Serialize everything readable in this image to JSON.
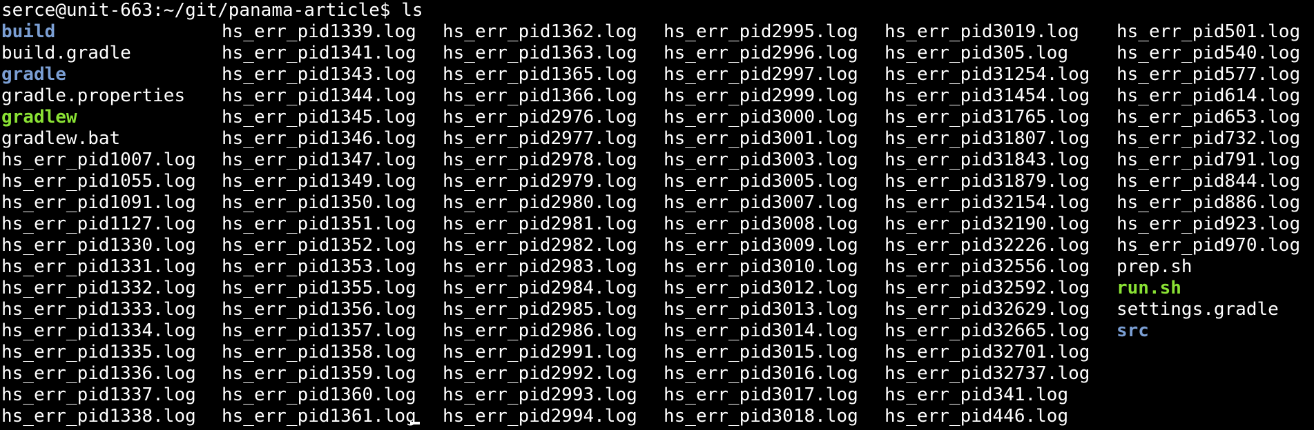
{
  "terminal": {
    "prompt": "serce@unit-663:~/git/panama-article$",
    "command": "ls"
  },
  "colors": {
    "background": "#000000",
    "text": "#ffffff",
    "directory": "#7b9fd4",
    "executable": "#8ae234"
  },
  "listing": {
    "columns": [
      [
        {
          "name": "build",
          "kind": "dir"
        },
        {
          "name": "build.gradle",
          "kind": "file"
        },
        {
          "name": "gradle",
          "kind": "dir"
        },
        {
          "name": "gradle.properties",
          "kind": "file"
        },
        {
          "name": "gradlew",
          "kind": "exec"
        },
        {
          "name": "gradlew.bat",
          "kind": "file"
        },
        {
          "name": "hs_err_pid1007.log",
          "kind": "file"
        },
        {
          "name": "hs_err_pid1055.log",
          "kind": "file"
        },
        {
          "name": "hs_err_pid1091.log",
          "kind": "file"
        },
        {
          "name": "hs_err_pid1127.log",
          "kind": "file"
        },
        {
          "name": "hs_err_pid1330.log",
          "kind": "file"
        },
        {
          "name": "hs_err_pid1331.log",
          "kind": "file"
        },
        {
          "name": "hs_err_pid1332.log",
          "kind": "file"
        },
        {
          "name": "hs_err_pid1333.log",
          "kind": "file"
        },
        {
          "name": "hs_err_pid1334.log",
          "kind": "file"
        },
        {
          "name": "hs_err_pid1335.log",
          "kind": "file"
        },
        {
          "name": "hs_err_pid1336.log",
          "kind": "file"
        },
        {
          "name": "hs_err_pid1337.log",
          "kind": "file"
        },
        {
          "name": "hs_err_pid1338.log",
          "kind": "file"
        }
      ],
      [
        {
          "name": "hs_err_pid1339.log",
          "kind": "file"
        },
        {
          "name": "hs_err_pid1341.log",
          "kind": "file"
        },
        {
          "name": "hs_err_pid1343.log",
          "kind": "file"
        },
        {
          "name": "hs_err_pid1344.log",
          "kind": "file"
        },
        {
          "name": "hs_err_pid1345.log",
          "kind": "file"
        },
        {
          "name": "hs_err_pid1346.log",
          "kind": "file"
        },
        {
          "name": "hs_err_pid1347.log",
          "kind": "file"
        },
        {
          "name": "hs_err_pid1349.log",
          "kind": "file"
        },
        {
          "name": "hs_err_pid1350.log",
          "kind": "file"
        },
        {
          "name": "hs_err_pid1351.log",
          "kind": "file"
        },
        {
          "name": "hs_err_pid1352.log",
          "kind": "file"
        },
        {
          "name": "hs_err_pid1353.log",
          "kind": "file"
        },
        {
          "name": "hs_err_pid1355.log",
          "kind": "file"
        },
        {
          "name": "hs_err_pid1356.log",
          "kind": "file"
        },
        {
          "name": "hs_err_pid1357.log",
          "kind": "file"
        },
        {
          "name": "hs_err_pid1358.log",
          "kind": "file"
        },
        {
          "name": "hs_err_pid1359.log",
          "kind": "file"
        },
        {
          "name": "hs_err_pid1360.log",
          "kind": "file"
        },
        {
          "name": "hs_err_pid1361.log",
          "kind": "file"
        }
      ],
      [
        {
          "name": "hs_err_pid1362.log",
          "kind": "file"
        },
        {
          "name": "hs_err_pid1363.log",
          "kind": "file"
        },
        {
          "name": "hs_err_pid1365.log",
          "kind": "file"
        },
        {
          "name": "hs_err_pid1366.log",
          "kind": "file"
        },
        {
          "name": "hs_err_pid2976.log",
          "kind": "file"
        },
        {
          "name": "hs_err_pid2977.log",
          "kind": "file"
        },
        {
          "name": "hs_err_pid2978.log",
          "kind": "file"
        },
        {
          "name": "hs_err_pid2979.log",
          "kind": "file"
        },
        {
          "name": "hs_err_pid2980.log",
          "kind": "file"
        },
        {
          "name": "hs_err_pid2981.log",
          "kind": "file"
        },
        {
          "name": "hs_err_pid2982.log",
          "kind": "file"
        },
        {
          "name": "hs_err_pid2983.log",
          "kind": "file"
        },
        {
          "name": "hs_err_pid2984.log",
          "kind": "file"
        },
        {
          "name": "hs_err_pid2985.log",
          "kind": "file"
        },
        {
          "name": "hs_err_pid2986.log",
          "kind": "file"
        },
        {
          "name": "hs_err_pid2991.log",
          "kind": "file"
        },
        {
          "name": "hs_err_pid2992.log",
          "kind": "file"
        },
        {
          "name": "hs_err_pid2993.log",
          "kind": "file"
        },
        {
          "name": "hs_err_pid2994.log",
          "kind": "file"
        }
      ],
      [
        {
          "name": "hs_err_pid2995.log",
          "kind": "file"
        },
        {
          "name": "hs_err_pid2996.log",
          "kind": "file"
        },
        {
          "name": "hs_err_pid2997.log",
          "kind": "file"
        },
        {
          "name": "hs_err_pid2999.log",
          "kind": "file"
        },
        {
          "name": "hs_err_pid3000.log",
          "kind": "file"
        },
        {
          "name": "hs_err_pid3001.log",
          "kind": "file"
        },
        {
          "name": "hs_err_pid3003.log",
          "kind": "file"
        },
        {
          "name": "hs_err_pid3005.log",
          "kind": "file"
        },
        {
          "name": "hs_err_pid3007.log",
          "kind": "file"
        },
        {
          "name": "hs_err_pid3008.log",
          "kind": "file"
        },
        {
          "name": "hs_err_pid3009.log",
          "kind": "file"
        },
        {
          "name": "hs_err_pid3010.log",
          "kind": "file"
        },
        {
          "name": "hs_err_pid3012.log",
          "kind": "file"
        },
        {
          "name": "hs_err_pid3013.log",
          "kind": "file"
        },
        {
          "name": "hs_err_pid3014.log",
          "kind": "file"
        },
        {
          "name": "hs_err_pid3015.log",
          "kind": "file"
        },
        {
          "name": "hs_err_pid3016.log",
          "kind": "file"
        },
        {
          "name": "hs_err_pid3017.log",
          "kind": "file"
        },
        {
          "name": "hs_err_pid3018.log",
          "kind": "file"
        }
      ],
      [
        {
          "name": "hs_err_pid3019.log",
          "kind": "file"
        },
        {
          "name": "hs_err_pid305.log",
          "kind": "file"
        },
        {
          "name": "hs_err_pid31254.log",
          "kind": "file"
        },
        {
          "name": "hs_err_pid31454.log",
          "kind": "file"
        },
        {
          "name": "hs_err_pid31765.log",
          "kind": "file"
        },
        {
          "name": "hs_err_pid31807.log",
          "kind": "file"
        },
        {
          "name": "hs_err_pid31843.log",
          "kind": "file"
        },
        {
          "name": "hs_err_pid31879.log",
          "kind": "file"
        },
        {
          "name": "hs_err_pid32154.log",
          "kind": "file"
        },
        {
          "name": "hs_err_pid32190.log",
          "kind": "file"
        },
        {
          "name": "hs_err_pid32226.log",
          "kind": "file"
        },
        {
          "name": "hs_err_pid32556.log",
          "kind": "file"
        },
        {
          "name": "hs_err_pid32592.log",
          "kind": "file"
        },
        {
          "name": "hs_err_pid32629.log",
          "kind": "file"
        },
        {
          "name": "hs_err_pid32665.log",
          "kind": "file"
        },
        {
          "name": "hs_err_pid32701.log",
          "kind": "file"
        },
        {
          "name": "hs_err_pid32737.log",
          "kind": "file"
        },
        {
          "name": "hs_err_pid341.log",
          "kind": "file"
        },
        {
          "name": "hs_err_pid446.log",
          "kind": "file"
        }
      ],
      [
        {
          "name": "hs_err_pid501.log",
          "kind": "file"
        },
        {
          "name": "hs_err_pid540.log",
          "kind": "file"
        },
        {
          "name": "hs_err_pid577.log",
          "kind": "file"
        },
        {
          "name": "hs_err_pid614.log",
          "kind": "file"
        },
        {
          "name": "hs_err_pid653.log",
          "kind": "file"
        },
        {
          "name": "hs_err_pid732.log",
          "kind": "file"
        },
        {
          "name": "hs_err_pid791.log",
          "kind": "file"
        },
        {
          "name": "hs_err_pid844.log",
          "kind": "file"
        },
        {
          "name": "hs_err_pid886.log",
          "kind": "file"
        },
        {
          "name": "hs_err_pid923.log",
          "kind": "file"
        },
        {
          "name": "hs_err_pid970.log",
          "kind": "file"
        },
        {
          "name": "prep.sh",
          "kind": "file"
        },
        {
          "name": "run.sh",
          "kind": "exec"
        },
        {
          "name": "settings.gradle",
          "kind": "file"
        },
        {
          "name": "src",
          "kind": "dir"
        }
      ]
    ]
  }
}
